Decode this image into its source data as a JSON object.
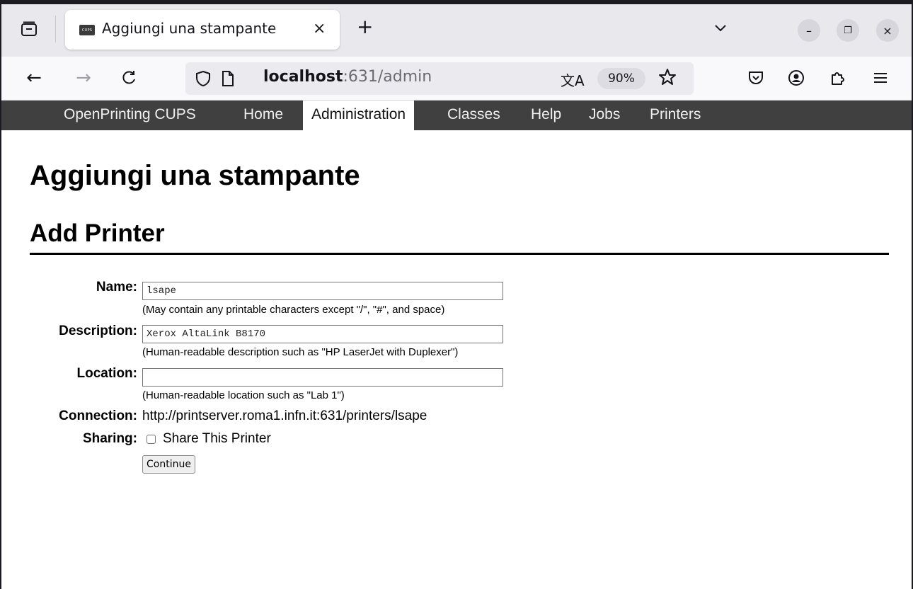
{
  "browser": {
    "tab": {
      "favicon_text": "CUPS",
      "title": "Aggiungi una stampante",
      "close_glyph": "×"
    },
    "new_tab_glyph": "+",
    "window_buttons": {
      "minimize": "–",
      "restore": "❐",
      "close": "×"
    },
    "nav": {
      "back": "←",
      "forward": "→",
      "reload": "C"
    },
    "url": {
      "host": "localhost",
      "path": ":631/admin"
    },
    "translate_glyph": "文A",
    "zoom": "90%"
  },
  "cups_nav": {
    "items": [
      {
        "label": "OpenPrinting CUPS"
      },
      {
        "label": "Home"
      },
      {
        "label": "Administration"
      },
      {
        "label": "Classes"
      },
      {
        "label": "Help"
      },
      {
        "label": "Jobs"
      },
      {
        "label": "Printers"
      }
    ]
  },
  "page": {
    "title": "Aggiungi una stampante",
    "section_title": "Add Printer"
  },
  "form": {
    "name_label": "Name:",
    "name_value": "lsape",
    "name_hint": "(May contain any printable characters except \"/\", \"#\", and space)",
    "description_label": "Description:",
    "description_value": "Xerox AltaLink B8170",
    "description_hint": "(Human-readable description such as \"HP LaserJet with Duplexer\")",
    "location_label": "Location:",
    "location_value": "",
    "location_hint": "(Human-readable location such as \"Lab 1\")",
    "connection_label": "Connection:",
    "connection_value": "http://printserver.roma1.infn.it:631/printers/lsape",
    "sharing_label": "Sharing:",
    "share_checkbox_label": "Share This Printer",
    "share_checked": false,
    "continue_label": "Continue"
  },
  "colors": {
    "cups_nav_bg": "#404040",
    "tabstrip_bg": "#e8e8ed",
    "urlbar_bg": "#ebebef"
  }
}
